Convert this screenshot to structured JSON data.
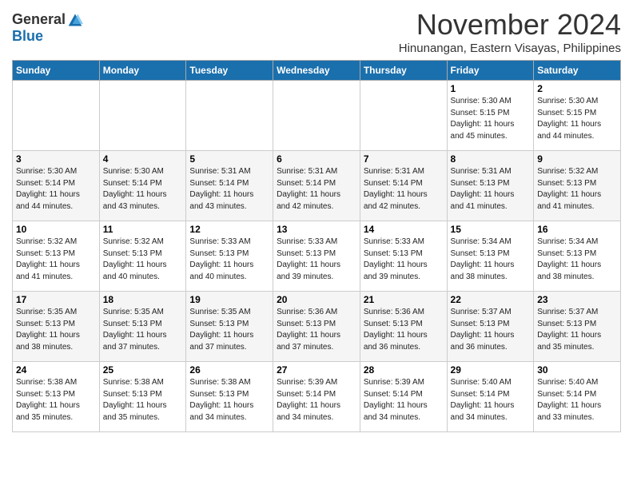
{
  "header": {
    "logo_general": "General",
    "logo_blue": "Blue",
    "month_title": "November 2024",
    "location": "Hinunangan, Eastern Visayas, Philippines"
  },
  "weekdays": [
    "Sunday",
    "Monday",
    "Tuesday",
    "Wednesday",
    "Thursday",
    "Friday",
    "Saturday"
  ],
  "weeks": [
    [
      {
        "day": "",
        "info": ""
      },
      {
        "day": "",
        "info": ""
      },
      {
        "day": "",
        "info": ""
      },
      {
        "day": "",
        "info": ""
      },
      {
        "day": "",
        "info": ""
      },
      {
        "day": "1",
        "info": "Sunrise: 5:30 AM\nSunset: 5:15 PM\nDaylight: 11 hours\nand 45 minutes."
      },
      {
        "day": "2",
        "info": "Sunrise: 5:30 AM\nSunset: 5:15 PM\nDaylight: 11 hours\nand 44 minutes."
      }
    ],
    [
      {
        "day": "3",
        "info": "Sunrise: 5:30 AM\nSunset: 5:14 PM\nDaylight: 11 hours\nand 44 minutes."
      },
      {
        "day": "4",
        "info": "Sunrise: 5:30 AM\nSunset: 5:14 PM\nDaylight: 11 hours\nand 43 minutes."
      },
      {
        "day": "5",
        "info": "Sunrise: 5:31 AM\nSunset: 5:14 PM\nDaylight: 11 hours\nand 43 minutes."
      },
      {
        "day": "6",
        "info": "Sunrise: 5:31 AM\nSunset: 5:14 PM\nDaylight: 11 hours\nand 42 minutes."
      },
      {
        "day": "7",
        "info": "Sunrise: 5:31 AM\nSunset: 5:14 PM\nDaylight: 11 hours\nand 42 minutes."
      },
      {
        "day": "8",
        "info": "Sunrise: 5:31 AM\nSunset: 5:13 PM\nDaylight: 11 hours\nand 41 minutes."
      },
      {
        "day": "9",
        "info": "Sunrise: 5:32 AM\nSunset: 5:13 PM\nDaylight: 11 hours\nand 41 minutes."
      }
    ],
    [
      {
        "day": "10",
        "info": "Sunrise: 5:32 AM\nSunset: 5:13 PM\nDaylight: 11 hours\nand 41 minutes."
      },
      {
        "day": "11",
        "info": "Sunrise: 5:32 AM\nSunset: 5:13 PM\nDaylight: 11 hours\nand 40 minutes."
      },
      {
        "day": "12",
        "info": "Sunrise: 5:33 AM\nSunset: 5:13 PM\nDaylight: 11 hours\nand 40 minutes."
      },
      {
        "day": "13",
        "info": "Sunrise: 5:33 AM\nSunset: 5:13 PM\nDaylight: 11 hours\nand 39 minutes."
      },
      {
        "day": "14",
        "info": "Sunrise: 5:33 AM\nSunset: 5:13 PM\nDaylight: 11 hours\nand 39 minutes."
      },
      {
        "day": "15",
        "info": "Sunrise: 5:34 AM\nSunset: 5:13 PM\nDaylight: 11 hours\nand 38 minutes."
      },
      {
        "day": "16",
        "info": "Sunrise: 5:34 AM\nSunset: 5:13 PM\nDaylight: 11 hours\nand 38 minutes."
      }
    ],
    [
      {
        "day": "17",
        "info": "Sunrise: 5:35 AM\nSunset: 5:13 PM\nDaylight: 11 hours\nand 38 minutes."
      },
      {
        "day": "18",
        "info": "Sunrise: 5:35 AM\nSunset: 5:13 PM\nDaylight: 11 hours\nand 37 minutes."
      },
      {
        "day": "19",
        "info": "Sunrise: 5:35 AM\nSunset: 5:13 PM\nDaylight: 11 hours\nand 37 minutes."
      },
      {
        "day": "20",
        "info": "Sunrise: 5:36 AM\nSunset: 5:13 PM\nDaylight: 11 hours\nand 37 minutes."
      },
      {
        "day": "21",
        "info": "Sunrise: 5:36 AM\nSunset: 5:13 PM\nDaylight: 11 hours\nand 36 minutes."
      },
      {
        "day": "22",
        "info": "Sunrise: 5:37 AM\nSunset: 5:13 PM\nDaylight: 11 hours\nand 36 minutes."
      },
      {
        "day": "23",
        "info": "Sunrise: 5:37 AM\nSunset: 5:13 PM\nDaylight: 11 hours\nand 35 minutes."
      }
    ],
    [
      {
        "day": "24",
        "info": "Sunrise: 5:38 AM\nSunset: 5:13 PM\nDaylight: 11 hours\nand 35 minutes."
      },
      {
        "day": "25",
        "info": "Sunrise: 5:38 AM\nSunset: 5:13 PM\nDaylight: 11 hours\nand 35 minutes."
      },
      {
        "day": "26",
        "info": "Sunrise: 5:38 AM\nSunset: 5:13 PM\nDaylight: 11 hours\nand 34 minutes."
      },
      {
        "day": "27",
        "info": "Sunrise: 5:39 AM\nSunset: 5:14 PM\nDaylight: 11 hours\nand 34 minutes."
      },
      {
        "day": "28",
        "info": "Sunrise: 5:39 AM\nSunset: 5:14 PM\nDaylight: 11 hours\nand 34 minutes."
      },
      {
        "day": "29",
        "info": "Sunrise: 5:40 AM\nSunset: 5:14 PM\nDaylight: 11 hours\nand 34 minutes."
      },
      {
        "day": "30",
        "info": "Sunrise: 5:40 AM\nSunset: 5:14 PM\nDaylight: 11 hours\nand 33 minutes."
      }
    ]
  ]
}
